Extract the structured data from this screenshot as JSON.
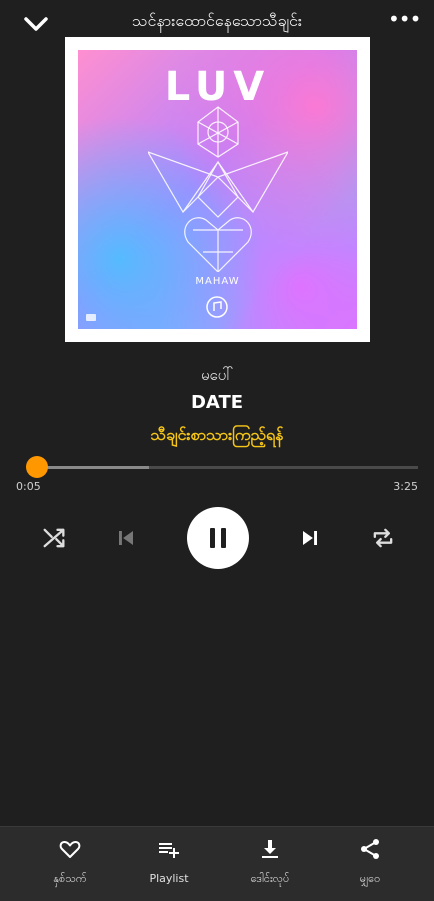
{
  "header": {
    "title": "သင်နားထောင်နေသောသီချင်း",
    "back_icon": "chevron-down-icon",
    "more_icon": "more-horizontal-icon",
    "more_glyph": "•••"
  },
  "album": {
    "title": "LUV",
    "artist": "MAHAW"
  },
  "track": {
    "artist": "မပေါ်",
    "title": "DATE",
    "lyrics_link": "သီချင်းစာသားကြည့်ရန်"
  },
  "progress": {
    "current_time": "0:05",
    "total_time": "3:25",
    "played_fraction": 0.024,
    "buffered_fraction": 0.31,
    "thumb_color": "#ff9800"
  },
  "controls": {
    "shuffle_icon": "shuffle-icon",
    "prev_icon": "skip-previous-icon",
    "play_state": "playing",
    "next_icon": "skip-next-icon",
    "repeat_icon": "repeat-icon"
  },
  "bottom_nav": [
    {
      "label": "နှစ်သက်",
      "icon": "heart-icon"
    },
    {
      "label": "Playlist",
      "icon": "playlist-add-icon"
    },
    {
      "label": "ဒေါင်းလုပ်",
      "icon": "download-icon"
    },
    {
      "label": "မျှဝေ",
      "icon": "share-icon"
    }
  ],
  "colors": {
    "background": "#1f1f1f",
    "accent": "#ff9800",
    "lyrics": "#f5c518",
    "bottom_bar": "#2c2c2c"
  }
}
